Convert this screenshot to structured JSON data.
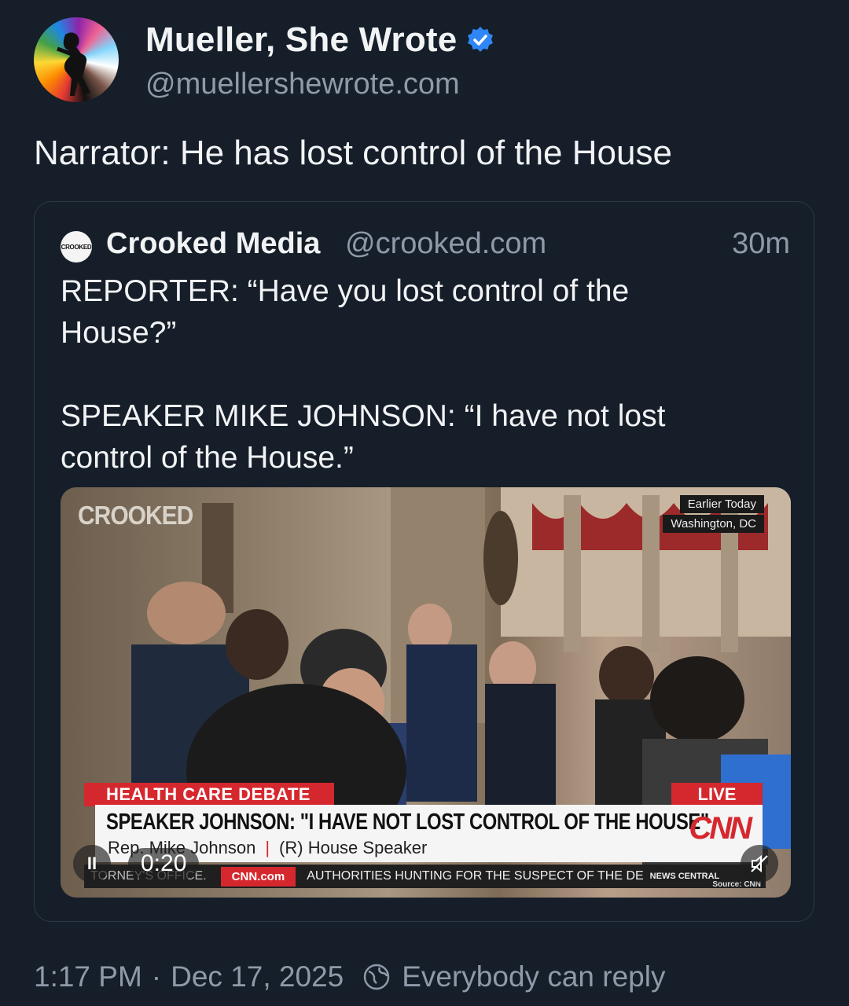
{
  "author": {
    "display_name": "Mueller, She Wrote",
    "handle": "@muellershewrote.com",
    "verified": true,
    "avatar_icon": "rainbow-silhouette-avatar"
  },
  "post": {
    "text": "Narrator: He has lost control of the House",
    "timestamp": "1:17 PM",
    "separator": "·",
    "date": "Dec 17, 2025",
    "reply_setting": "Everybody can reply"
  },
  "quote": {
    "avatar_text": "CROOKED",
    "display_name": "Crooked Media",
    "handle": "@crooked.com",
    "time": "30m",
    "lines": [
      "REPORTER: “Have you lost control of the",
      "House?”",
      "SPEAKER MIKE JOHNSON: “I have not lost",
      "control of the House.”"
    ]
  },
  "video": {
    "watermark": "CROOKED",
    "location_top": "Earlier Today",
    "location_bottom": "Washington, DC",
    "tag": "HEALTH CARE DEBATE",
    "live": "LIVE",
    "headline": "SPEAKER JOHNSON: \"I HAVE NOT LOST CONTROL OF THE HOUSE\"",
    "subline_name": "Rep. Mike Johnson",
    "subline_sep": "|",
    "subline_role": "(R) House Speaker",
    "network_logo": "CNN",
    "ticker_prev": "TORNEY'S OFFICE.",
    "ticker_logo": "CNN.com",
    "ticker_text": "AUTHORITIES HUNTING FOR THE SUSPECT OF THE DE",
    "ticker_tail": "NEWS CENTRAL",
    "source": "Source: CNN",
    "elapsed": "0:20",
    "pause_glyph": "II"
  }
}
